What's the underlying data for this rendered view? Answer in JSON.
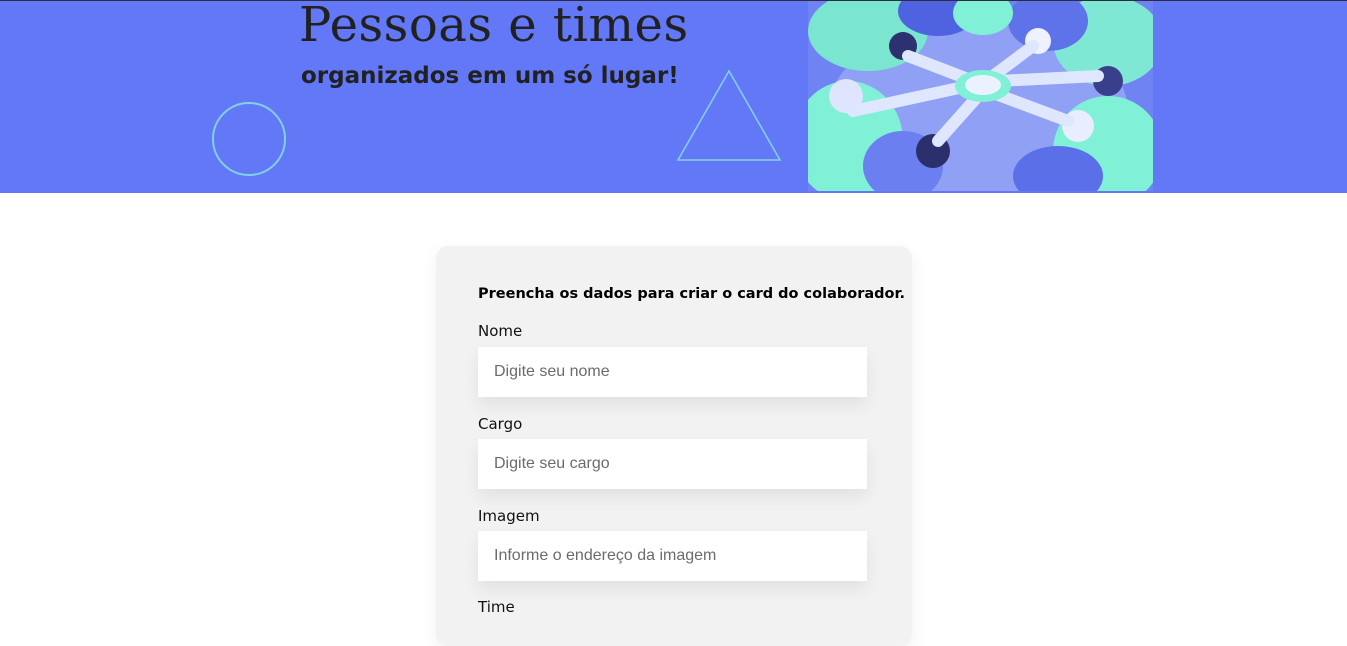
{
  "banner": {
    "title": "Pessoas e times",
    "subtitle": "organizados em um só lugar!",
    "photo_icon": "team-hands-photo",
    "deco_circle_icon": "circle-outline-icon",
    "deco_triangle_icon": "triangle-outline-icon"
  },
  "form": {
    "heading": "Preencha os dados para criar o card do colaborador.",
    "fields": [
      {
        "label": "Nome",
        "placeholder": "Digite seu nome",
        "value": ""
      },
      {
        "label": "Cargo",
        "placeholder": "Digite seu cargo",
        "value": ""
      },
      {
        "label": "Imagem",
        "placeholder": "Informe o endereço da imagem",
        "value": ""
      },
      {
        "label": "Time"
      }
    ]
  },
  "colors": {
    "banner_bg": "#6278f7",
    "accent_teal": "#82cfe8",
    "photo_highlight": "#80f0d6",
    "card_bg": "#f2f2f2",
    "text_dark": "#212121"
  }
}
